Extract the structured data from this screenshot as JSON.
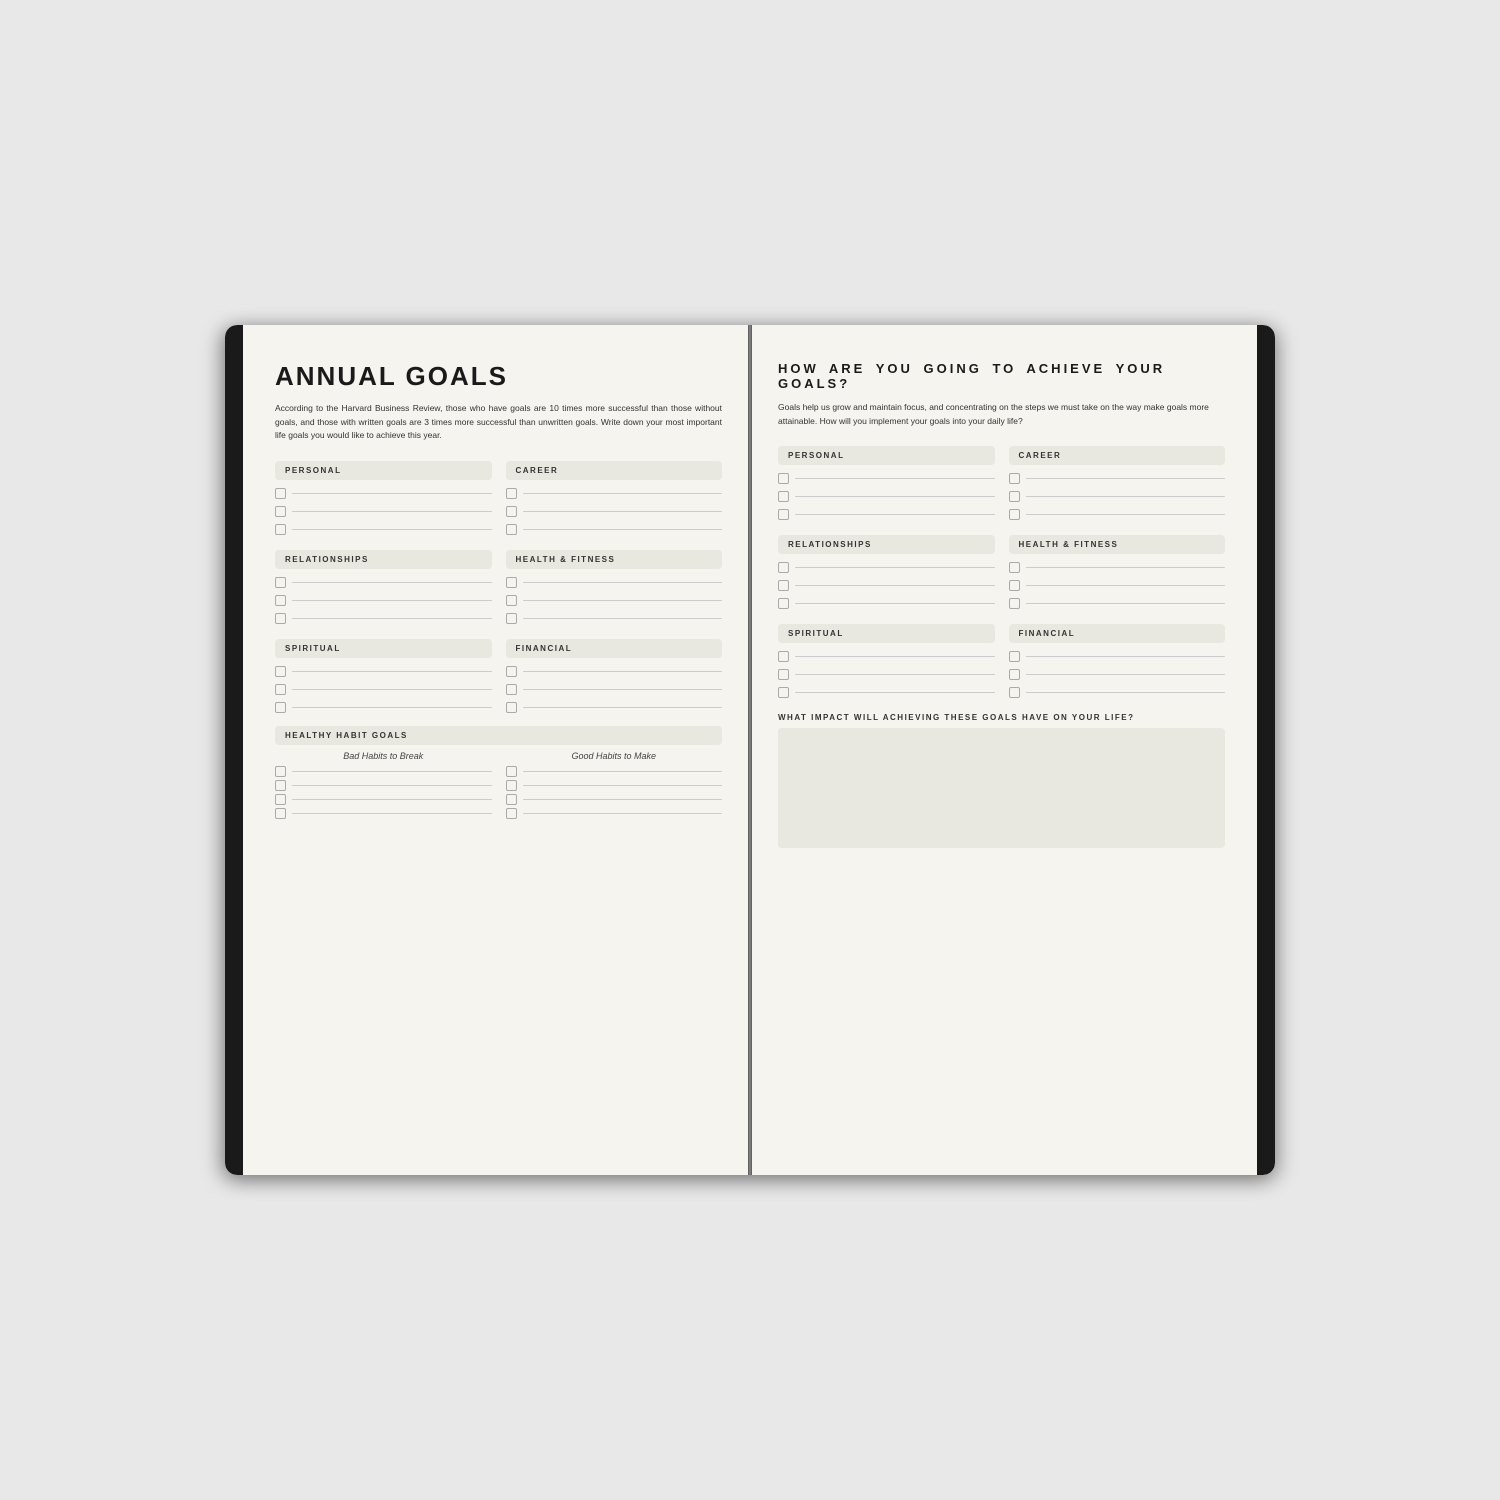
{
  "left_page": {
    "title": "ANNUAL GOALS",
    "intro": "According to the Harvard Business Review, those who have goals are 10 times more successful than those without goals, and those with written goals are 3 times more successful than unwritten goals.  Write down your most important life goals you would like to achieve this year.",
    "sections": [
      {
        "id": "personal",
        "label": "PERSONAL"
      },
      {
        "id": "career",
        "label": "CAREER"
      },
      {
        "id": "relationships",
        "label": "RELATIONSHIPS"
      },
      {
        "id": "health-fitness",
        "label": "HEALTH & FITNESS"
      },
      {
        "id": "spiritual",
        "label": "SPIRITUAL"
      },
      {
        "id": "financial",
        "label": "FINANCIAL"
      }
    ],
    "healthy_habits": {
      "label": "HEALTHY HABIT GOALS",
      "col1_label": "Bad Habits to Break",
      "col2_label": "Good Habits to Make"
    }
  },
  "right_page": {
    "title": "HOW ARE YOU GOING TO ACHIEVE YOUR GOALS?",
    "intro": "Goals help us grow and maintain focus, and concentrating on the steps we must take on the way make goals more attainable. How will you implement your goals into your daily life?",
    "sections": [
      {
        "id": "personal",
        "label": "PERSONAL"
      },
      {
        "id": "career",
        "label": "CAREER"
      },
      {
        "id": "relationships",
        "label": "RELATIONSHIPS"
      },
      {
        "id": "health-fitness",
        "label": "HEALTH & FITNESS"
      },
      {
        "id": "spiritual",
        "label": "SPIRITUAL"
      },
      {
        "id": "financial",
        "label": "FINANCIAL"
      }
    ],
    "impact": {
      "label": "WHAT IMPACT WILL ACHIEVING THESE GOALS HAVE ON YOUR LIFE?"
    }
  }
}
